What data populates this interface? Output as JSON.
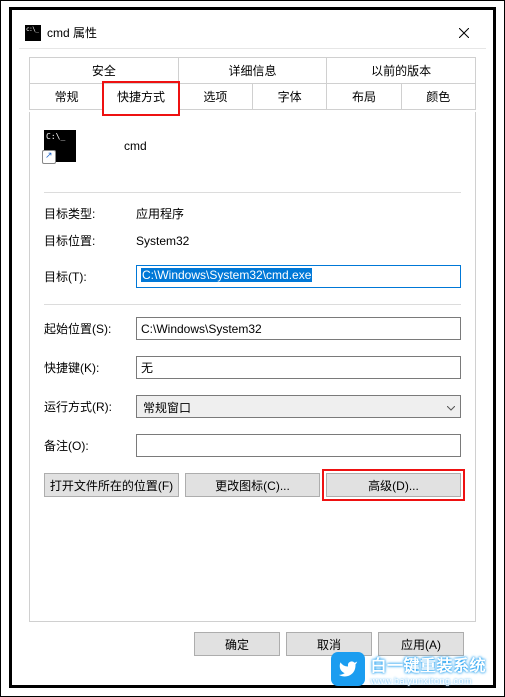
{
  "window": {
    "title": "cmd 属性"
  },
  "tabs_row1": [
    {
      "label": "安全"
    },
    {
      "label": "详细信息"
    },
    {
      "label": "以前的版本"
    }
  ],
  "tabs_row2": [
    {
      "label": "常规"
    },
    {
      "label": "快捷方式"
    },
    {
      "label": "选项"
    },
    {
      "label": "字体"
    },
    {
      "label": "布局"
    },
    {
      "label": "颜色"
    }
  ],
  "app": {
    "name": "cmd"
  },
  "fields": {
    "target_type_label": "目标类型:",
    "target_type_value": "应用程序",
    "target_location_label": "目标位置:",
    "target_location_value": "System32",
    "target_label": "目标(T):",
    "target_value": "C:\\Windows\\System32\\cmd.exe",
    "start_in_label": "起始位置(S):",
    "start_in_value": "C:\\Windows\\System32",
    "shortcut_key_label": "快捷键(K):",
    "shortcut_key_value": "无",
    "run_label": "运行方式(R):",
    "run_value": "常规窗口",
    "comment_label": "备注(O):",
    "comment_value": ""
  },
  "buttons": {
    "open_location": "打开文件所在的位置(F)",
    "change_icon": "更改图标(C)...",
    "advanced": "高级(D)...",
    "ok": "确定",
    "cancel": "取消",
    "apply": "应用(A)"
  },
  "watermark": {
    "line1": "白一键重装系统",
    "line2": "www.baiyunxitong.com"
  }
}
